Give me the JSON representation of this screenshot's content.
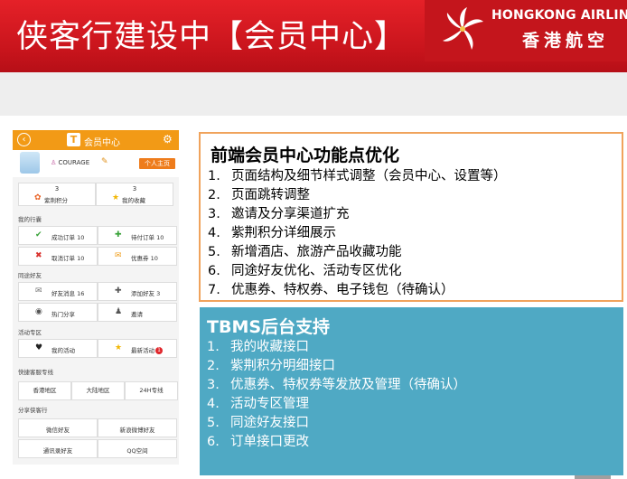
{
  "banner": {
    "title": "侠客行建设中【会员中心】",
    "brand_en": "HONGKONG AIRLINES",
    "brand_cn": "香港航空"
  },
  "phone": {
    "header_title": "会员中心",
    "header_logo": "T",
    "username": "COURAGE",
    "home_button": "个人主页",
    "stats": [
      {
        "value": "3",
        "label": "紫荆积分",
        "icon": "bauhinia-icon"
      },
      {
        "value": "3",
        "label": "我的收藏",
        "icon": "star-icon"
      }
    ],
    "sections": {
      "trips": "我的行囊",
      "friends": "同途好友",
      "activity": "活动专区",
      "hotline": "快捷客服专线",
      "share": "分享侠客行"
    },
    "trips": [
      {
        "label": "成功订单",
        "count": "10"
      },
      {
        "label": "待付订单",
        "count": "10"
      },
      {
        "label": "取消订单",
        "count": "10"
      },
      {
        "label": "优惠券",
        "count": "10"
      }
    ],
    "friends": [
      {
        "label": "好友消息",
        "count": "16"
      },
      {
        "label": "添加好友",
        "count": "3"
      },
      {
        "label": "热门分享",
        "count": ""
      },
      {
        "label": "邀请",
        "count": ""
      }
    ],
    "activity": [
      {
        "label": "我的活动"
      },
      {
        "label": "最新活动",
        "badge": "1"
      }
    ],
    "hotline": [
      "香港地区",
      "大陆地区",
      "24H专线"
    ],
    "share": [
      "微信好友",
      "新浪微博好友",
      "通讯录好友",
      "QQ空间"
    ]
  },
  "front": {
    "title": "前端会员中心功能点优化",
    "items": [
      "页面结构及细节样式调整（会员中心、设置等）",
      "页面跳转调整",
      "邀请及分享渠道扩充",
      "紫荆积分详细展示",
      "新增酒店、旅游产品收藏功能",
      "同途好友优化、活动专区优化",
      "优惠券、特权券、电子钱包（待确认）"
    ]
  },
  "tbms": {
    "title": "TBMS后台支持",
    "items": [
      "我的收藏接口",
      "紫荆积分明细接口",
      "优惠券、特权券等发放及管理（待确认）",
      "活动专区管理",
      "同途好友接口",
      "订单接口更改"
    ]
  },
  "colors": {
    "banner_red": "#d41920",
    "phone_orange": "#f29a16",
    "front_border": "#f0a35c",
    "tbms_blue": "#4fa9c4"
  }
}
